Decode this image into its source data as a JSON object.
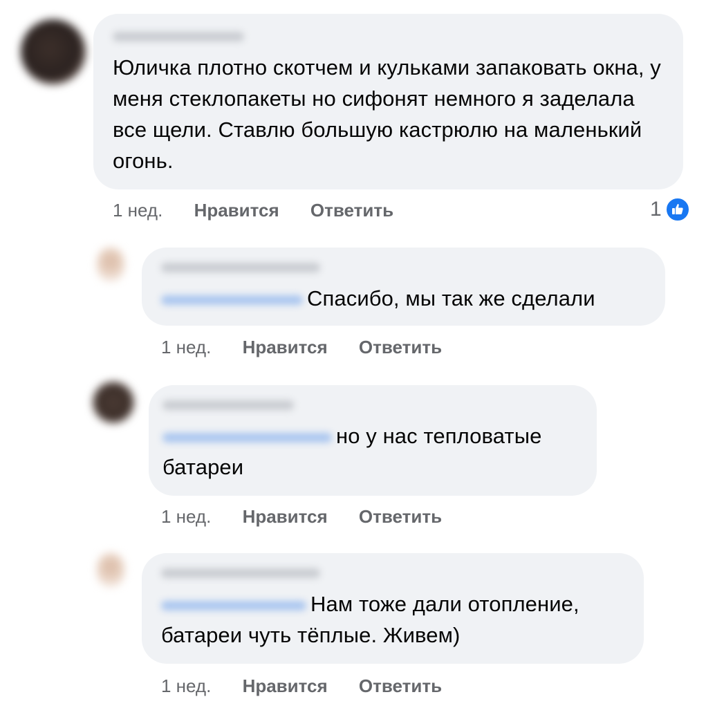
{
  "comments": [
    {
      "text": "Юличка плотно скотчем и кульками запаковать окна, у меня стеклопакеты но сифонят немного я заделала все щели. Ставлю большую кастрюлю на маленький огонь.",
      "time": "1 нед.",
      "like": "Нравится",
      "reply": "Ответить",
      "reaction_count": "1"
    },
    {
      "text": "Спасибо, мы так же сделали",
      "time": "1 нед.",
      "like": "Нравится",
      "reply": "Ответить"
    },
    {
      "text": "но у нас тепловатые батареи",
      "time": "1 нед.",
      "like": "Нравится",
      "reply": "Ответить"
    },
    {
      "text": "Нам тоже дали отопление, батареи чуть тёплые. Живем)",
      "time": "1 нед.",
      "like": "Нравится",
      "reply": "Ответить"
    }
  ],
  "colors": {
    "bubble": "#f0f2f5",
    "meta_text": "#65676b",
    "like_blue": "#1877f2"
  },
  "icons": {
    "reaction": "thumbs-up-icon"
  }
}
